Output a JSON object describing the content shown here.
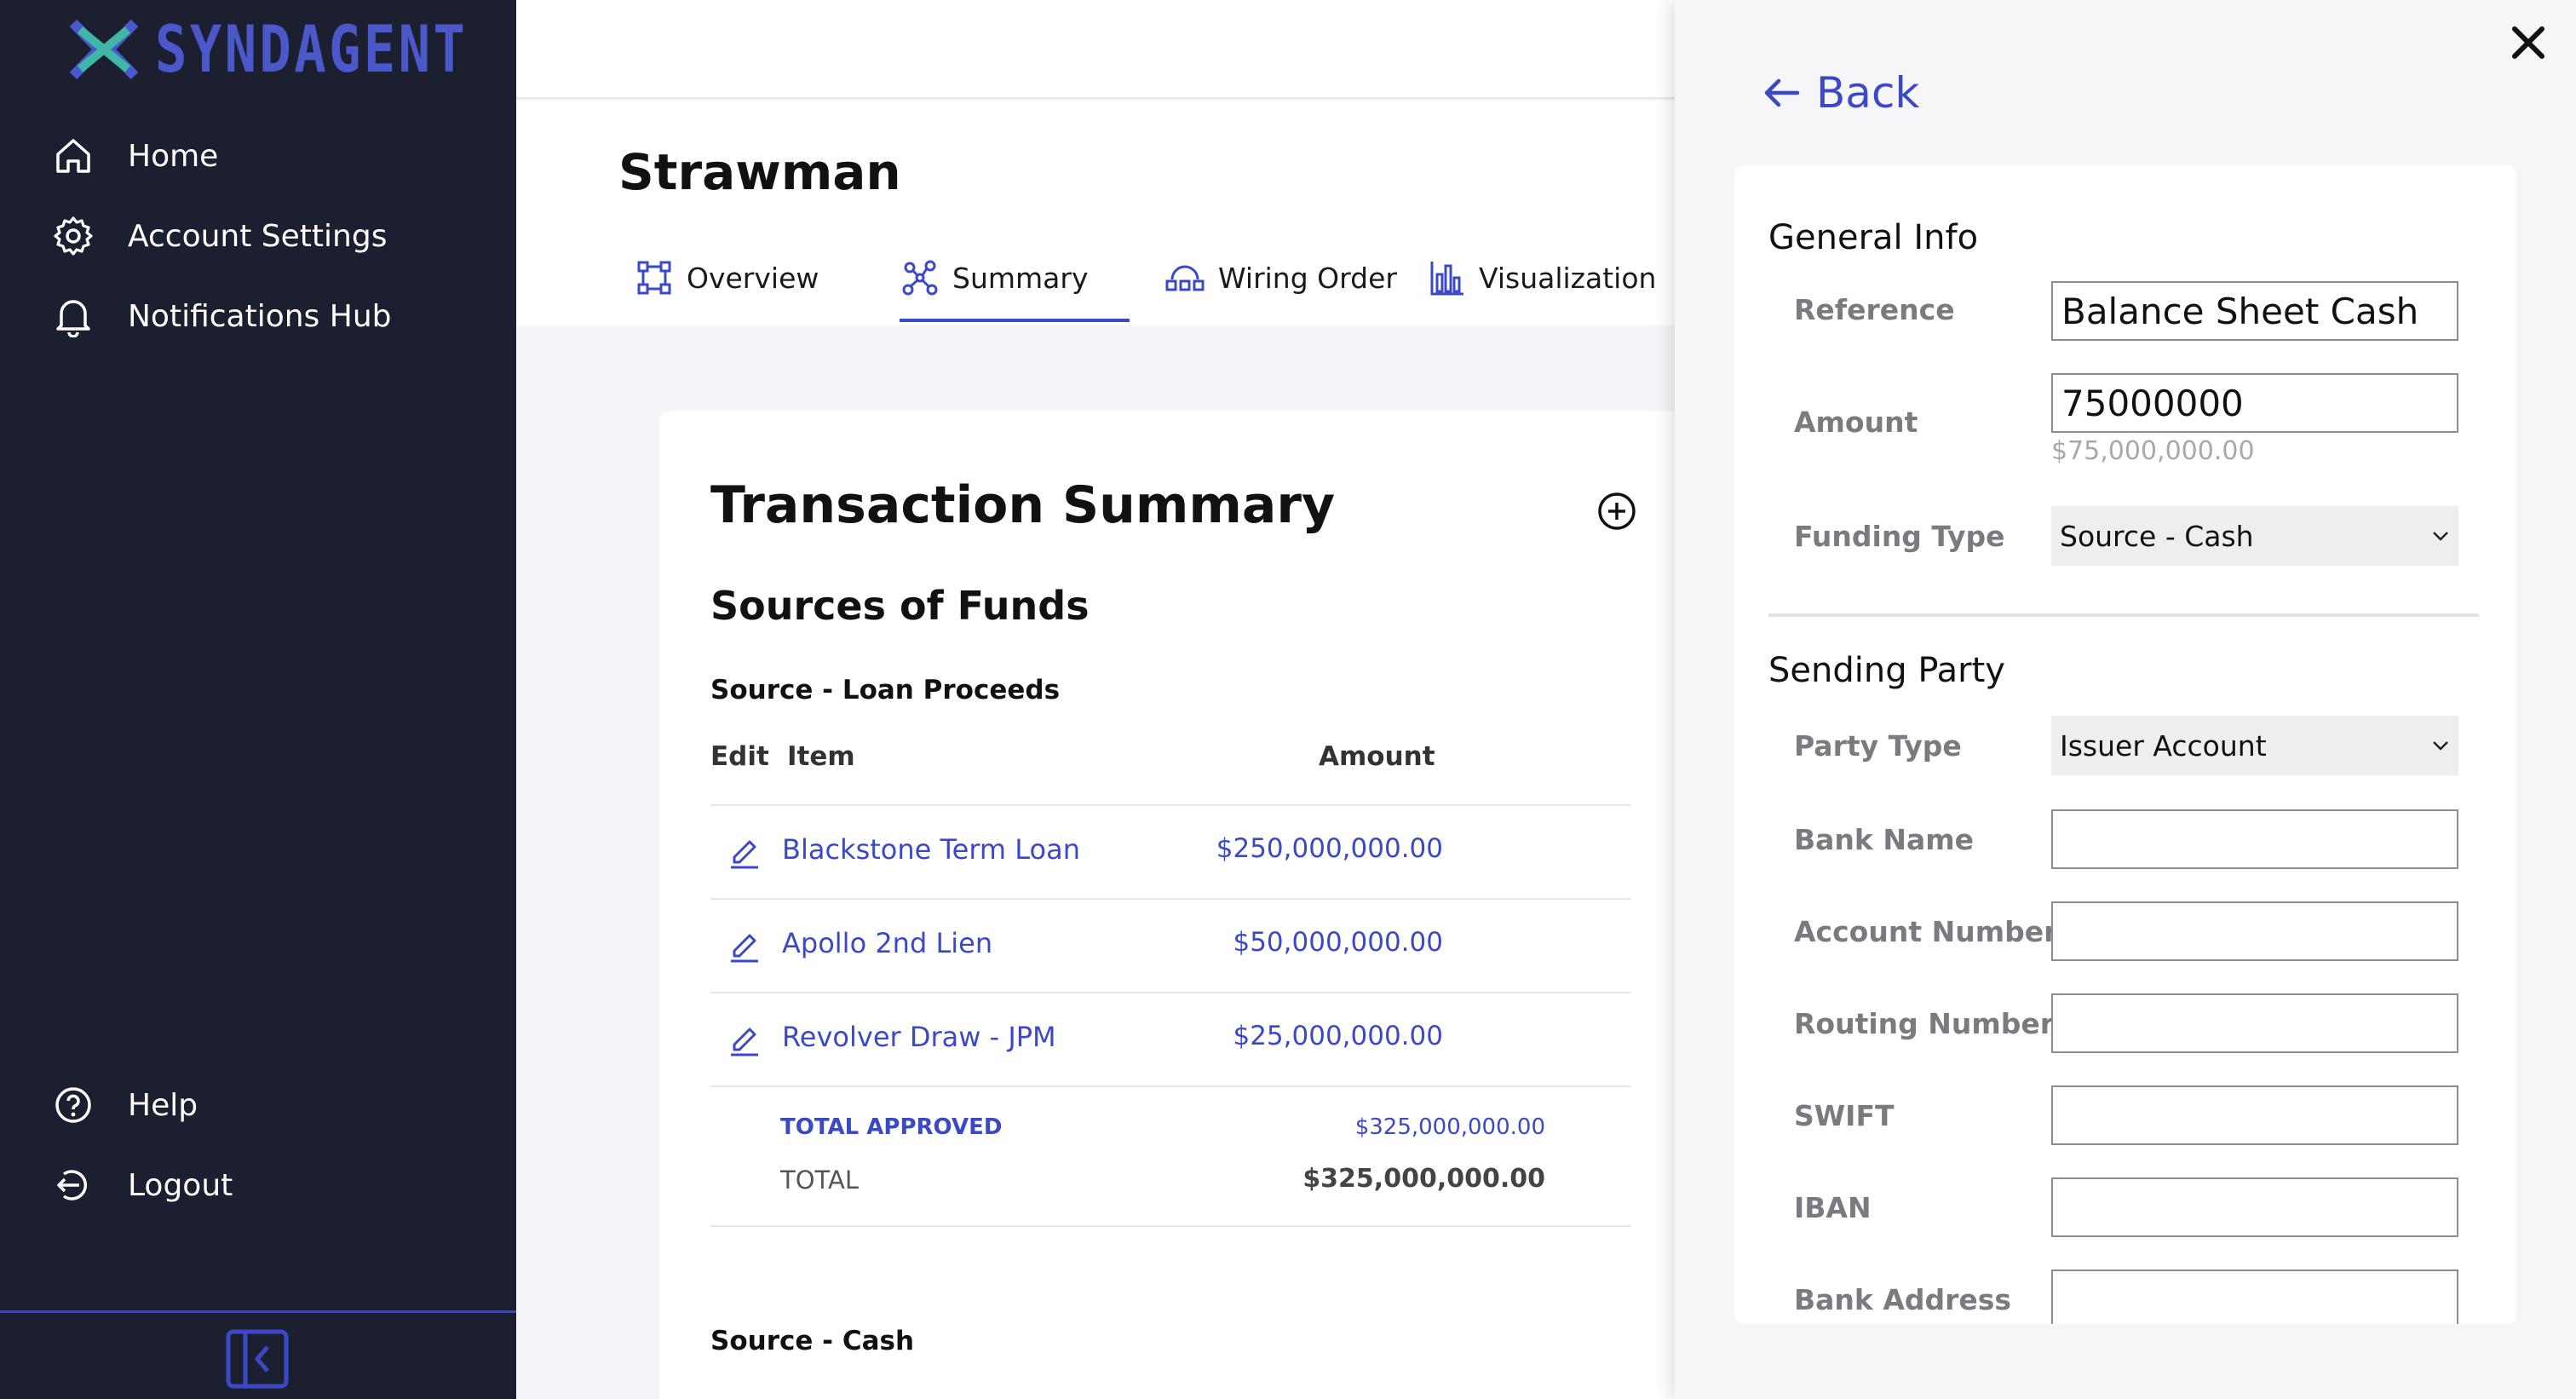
{
  "brand": {
    "name": "SYNDAGENT",
    "accent": "#3b49c6",
    "sidebar_bg": "#1c1f30"
  },
  "sidebar": {
    "top_items": [
      {
        "label": "Home",
        "icon": "home-icon"
      },
      {
        "label": "Account Settings",
        "icon": "gear-icon"
      },
      {
        "label": "Notifications Hub",
        "icon": "bell-icon"
      }
    ],
    "bottom_items": [
      {
        "label": "Help",
        "icon": "help-icon"
      },
      {
        "label": "Logout",
        "icon": "logout-icon"
      }
    ]
  },
  "page": {
    "title": "Strawman",
    "tabs": [
      {
        "label": "Overview",
        "icon": "overview-icon"
      },
      {
        "label": "Summary",
        "icon": "summary-icon",
        "active": true
      },
      {
        "label": "Wiring Order",
        "icon": "wiring-icon"
      },
      {
        "label": "Visualization",
        "icon": "chart-icon"
      }
    ]
  },
  "summary": {
    "title": "Transaction Summary",
    "section": "Sources of Funds",
    "group1": {
      "title": "Source - Loan Proceeds",
      "headers": {
        "edit": "Edit",
        "item": "Item",
        "amount": "Amount"
      },
      "rows": [
        {
          "item": "Blackstone Term Loan",
          "amount": "$250,000,000.00"
        },
        {
          "item": "Apollo 2nd Lien",
          "amount": "$50,000,000.00"
        },
        {
          "item": "Revolver Draw - JPM",
          "amount": "$25,000,000.00"
        }
      ],
      "total_approved_label": "TOTAL APPROVED",
      "total_approved": "$325,000,000.00",
      "total_label": "TOTAL",
      "total": "$325,000,000.00"
    },
    "group2": {
      "title": "Source - Cash"
    }
  },
  "drawer": {
    "back_label": "Back",
    "general": {
      "title": "General Info",
      "reference_label": "Reference",
      "reference_value": "Balance Sheet Cash",
      "amount_label": "Amount",
      "amount_value": "75000000",
      "amount_formatted": "$75,000,000.00",
      "funding_type_label": "Funding Type",
      "funding_type_value": "Source - Cash"
    },
    "sending": {
      "title": "Sending Party",
      "party_type_label": "Party Type",
      "party_type_value": "Issuer Account",
      "bank_name_label": "Bank Name",
      "account_number_label": "Account Number",
      "routing_number_label": "Routing Number",
      "swift_label": "SWIFT",
      "iban_label": "IBAN",
      "bank_address_label": "Bank Address"
    }
  }
}
